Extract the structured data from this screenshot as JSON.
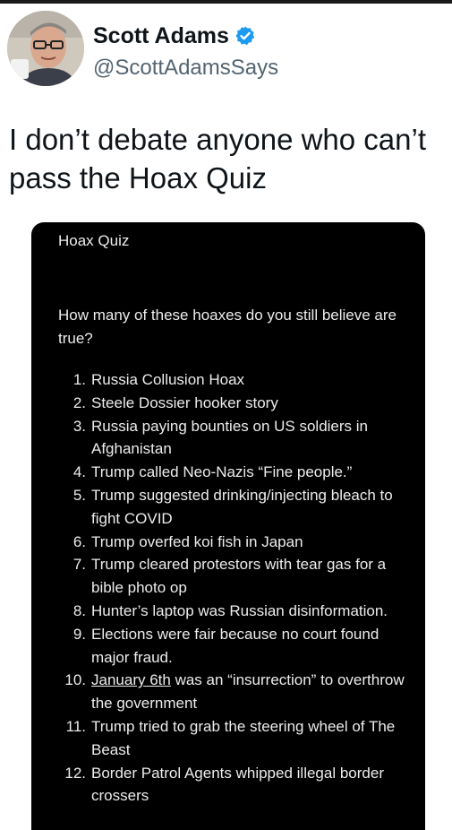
{
  "author": {
    "display_name": "Scott Adams",
    "handle": "@ScottAdamsSays",
    "verified_icon": "verified-badge-icon",
    "brand_color": "#1d9bf0"
  },
  "tweet": {
    "text": "I don’t debate anyone who can’t pass the Hoax Quiz"
  },
  "quiz": {
    "title": "Hoax Quiz",
    "question": "How many of these hoaxes do you still believe are true?",
    "items": [
      {
        "num": "1.",
        "text": "Russia Collusion Hoax"
      },
      {
        "num": "2.",
        "text": "Steele Dossier hooker story"
      },
      {
        "num": "3.",
        "text": "Russia paying bounties on US soldiers in Afghanistan"
      },
      {
        "num": "4.",
        "text": "Trump called Neo-Nazis “Fine people.”"
      },
      {
        "num": "5.",
        "text": "Trump suggested drinking/injecting bleach to fight COVID"
      },
      {
        "num": "6.",
        "text": "Trump overfed koi fish in Japan"
      },
      {
        "num": "7.",
        "text": "Trump cleared protestors with tear gas for a bible photo op"
      },
      {
        "num": "8.",
        "text": "Hunter’s laptop was Russian disinformation."
      },
      {
        "num": "9.",
        "text": "Elections were fair because no court found major fraud."
      },
      {
        "num": "10.",
        "text_underlined": "January 6th",
        "text_rest": " was an “insurrection” to overthrow the government"
      },
      {
        "num": "11.",
        "text": "Trump tried to grab the steering wheel of The Beast"
      },
      {
        "num": "12.",
        "text": "Border Patrol Agents whipped illegal border crossers"
      }
    ]
  }
}
